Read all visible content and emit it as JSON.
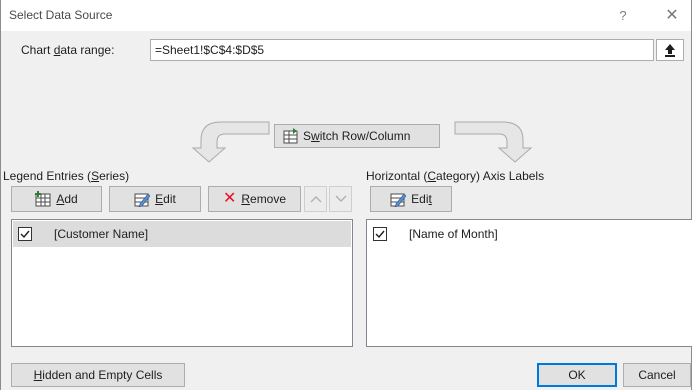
{
  "dialog": {
    "title": "Select Data Source",
    "help_glyph": "?",
    "close_glyph": "✕"
  },
  "range": {
    "label_pre": "Chart ",
    "label_accel": "d",
    "label_post": "ata range:",
    "value": "=Sheet1!$C$4:$D$5",
    "collapse_icon": "collapse-dialog-icon"
  },
  "switch": {
    "label_pre": "S",
    "label_accel": "w",
    "label_post": "itch Row/Column",
    "icon": "switch-row-column-icon"
  },
  "legend": {
    "label_pre": "Legend Entries (",
    "label_accel": "S",
    "label_post": "eries)",
    "add_pre": "",
    "add_accel": "A",
    "add_post": "dd",
    "edit_pre": "",
    "edit_accel": "E",
    "edit_post": "dit",
    "remove_pre": "",
    "remove_accel": "R",
    "remove_post": "emove",
    "items": [
      {
        "label": "[Customer Name]",
        "checked": true
      }
    ]
  },
  "category": {
    "label_pre": "Horizontal (",
    "label_accel": "C",
    "label_post": "ategory) Axis Labels",
    "edit_pre": "Edi",
    "edit_accel": "t",
    "edit_post": "",
    "items": [
      {
        "label": "[Name of Month]",
        "checked": true
      }
    ]
  },
  "footer": {
    "hidden_pre": "",
    "hidden_accel": "H",
    "hidden_post": "idden and Empty Cells",
    "ok_label": "OK",
    "cancel_label": "Cancel"
  },
  "colors": {
    "accent": "#0078d7",
    "remove_x": "#e81123"
  }
}
